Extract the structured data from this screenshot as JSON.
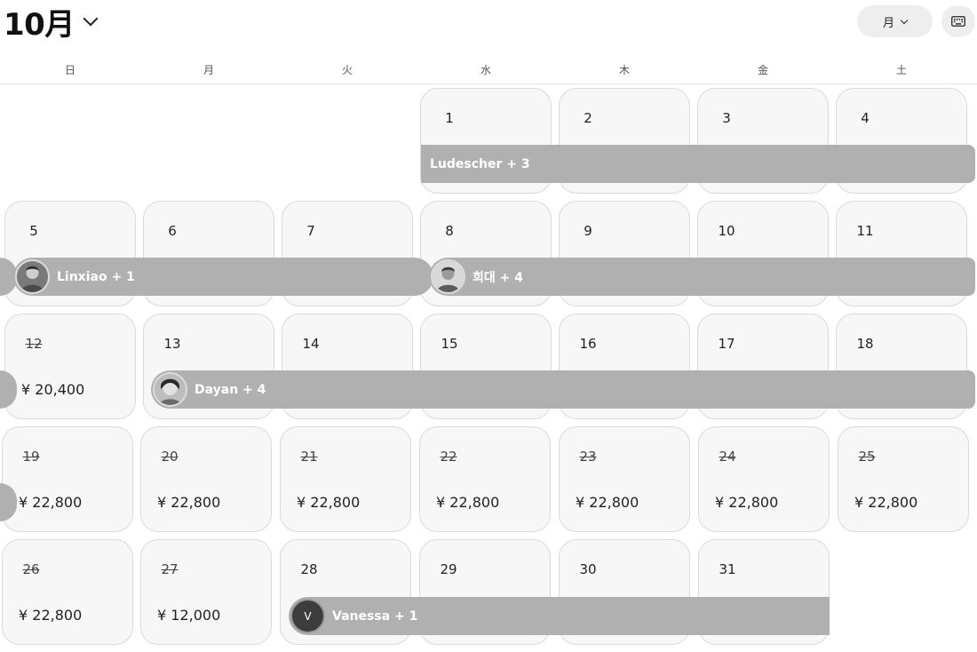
{
  "header": {
    "month_label": "10月",
    "view_label": "月"
  },
  "weekdays": [
    "日",
    "月",
    "火",
    "水",
    "木",
    "金",
    "土"
  ],
  "days": [
    {
      "num": "1"
    },
    {
      "num": "2"
    },
    {
      "num": "3"
    },
    {
      "num": "4"
    },
    {
      "num": "5"
    },
    {
      "num": "6"
    },
    {
      "num": "7"
    },
    {
      "num": "8"
    },
    {
      "num": "9"
    },
    {
      "num": "10"
    },
    {
      "num": "11"
    },
    {
      "num": "12",
      "price": "¥ 20,400"
    },
    {
      "num": "13"
    },
    {
      "num": "14"
    },
    {
      "num": "15"
    },
    {
      "num": "16"
    },
    {
      "num": "17"
    },
    {
      "num": "18"
    },
    {
      "num": "19",
      "price": "¥ 22,800"
    },
    {
      "num": "20",
      "price": "¥ 22,800"
    },
    {
      "num": "21",
      "price": "¥ 22,800"
    },
    {
      "num": "22",
      "price": "¥ 22,800"
    },
    {
      "num": "23",
      "price": "¥ 22,800"
    },
    {
      "num": "24",
      "price": "¥ 22,800"
    },
    {
      "num": "25",
      "price": "¥ 22,800"
    },
    {
      "num": "26",
      "price": "¥ 22,800"
    },
    {
      "num": "27",
      "price": "¥ 12,000"
    },
    {
      "num": "28"
    },
    {
      "num": "29"
    },
    {
      "num": "30"
    },
    {
      "num": "31"
    }
  ],
  "bookings": [
    {
      "name": "Ludescher + 3"
    },
    {
      "name": "Linxiao + 1"
    },
    {
      "name": "희대 + 4"
    },
    {
      "name": "Dayan + 4"
    },
    {
      "name": "Vanessa + 1",
      "initial": "V"
    }
  ],
  "colors": {
    "booking_bar": "#b0b0b0",
    "cell_bg": "#f7f7f7",
    "cell_border": "#dadada"
  }
}
